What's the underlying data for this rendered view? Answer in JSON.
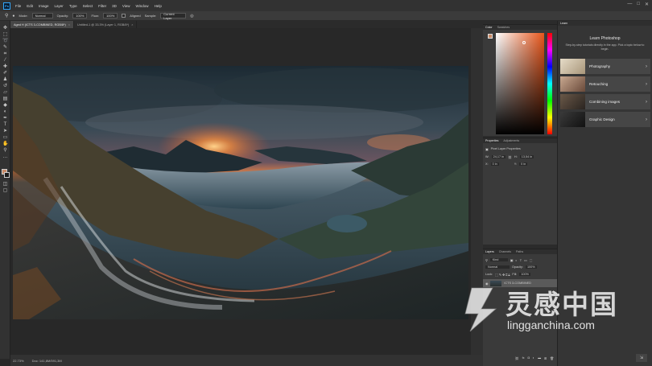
{
  "menu": {
    "app_logo": "Ps",
    "items": [
      "File",
      "Edit",
      "Image",
      "Layer",
      "Type",
      "Select",
      "Filter",
      "3D",
      "View",
      "Window",
      "Help"
    ]
  },
  "window_controls": {
    "minimize": "—",
    "maximize": "□",
    "close": "✕"
  },
  "options_bar": {
    "mode_label": "Mode:",
    "mode_value": "Normal",
    "opacity_label": "Opacity:",
    "opacity_value": "100%",
    "flow_label": "Flow:",
    "flow_value": "100%",
    "aligned_label": "Aligned",
    "sample_label": "Sample:",
    "sample_value": "Current Layer"
  },
  "tabs": [
    {
      "label": "Aged H (ICTS 3-COMBINED, RGB/8*)",
      "active": true
    },
    {
      "label": "Untitled-1 @ 33.3% (Layer 1, RGB/8*)",
      "active": false
    }
  ],
  "status": {
    "zoom": "22.73%",
    "doc": "Doc: 141,6M/591,3M"
  },
  "color_panel": {
    "tabs": [
      "Color",
      "Swatches"
    ],
    "hue_color": "#e8561b"
  },
  "properties_panel": {
    "tabs": [
      "Properties",
      "Adjustments"
    ],
    "title": "Pixel Layer Properties",
    "w_label": "W:",
    "w_value": "24,17 in",
    "h_label": "H:",
    "h_value": "13,54 in",
    "x_label": "X:",
    "x_value": "0 in",
    "y_label": "Y:",
    "y_value": "0 in"
  },
  "layers_panel": {
    "tabs": [
      "Layers",
      "Channels",
      "Paths"
    ],
    "kind_value": "Kind",
    "blend_value": "Normal",
    "opacity_label": "Opacity:",
    "opacity_value": "100%",
    "lock_label": "Lock:",
    "fill_label": "Fill:",
    "fill_value": "100%",
    "layer_name": "ICTS 3-COMBINED"
  },
  "learn_panel": {
    "tab": "Learn",
    "title": "Learn Photoshop",
    "description": "Step-by-step tutorials directly in the app. Pick a topic below to begin.",
    "topics": [
      {
        "label": "Photography",
        "thumb_color": "#c9b89a"
      },
      {
        "label": "Retouching",
        "thumb_color": "#8a6a55"
      },
      {
        "label": "Combining images",
        "thumb_color": "#4b4238"
      },
      {
        "label": "Graphic Design",
        "thumb_color": "#2a2a2a"
      }
    ]
  },
  "watermark": {
    "brand": "灵感中国",
    "url": "lingganchina.com"
  }
}
